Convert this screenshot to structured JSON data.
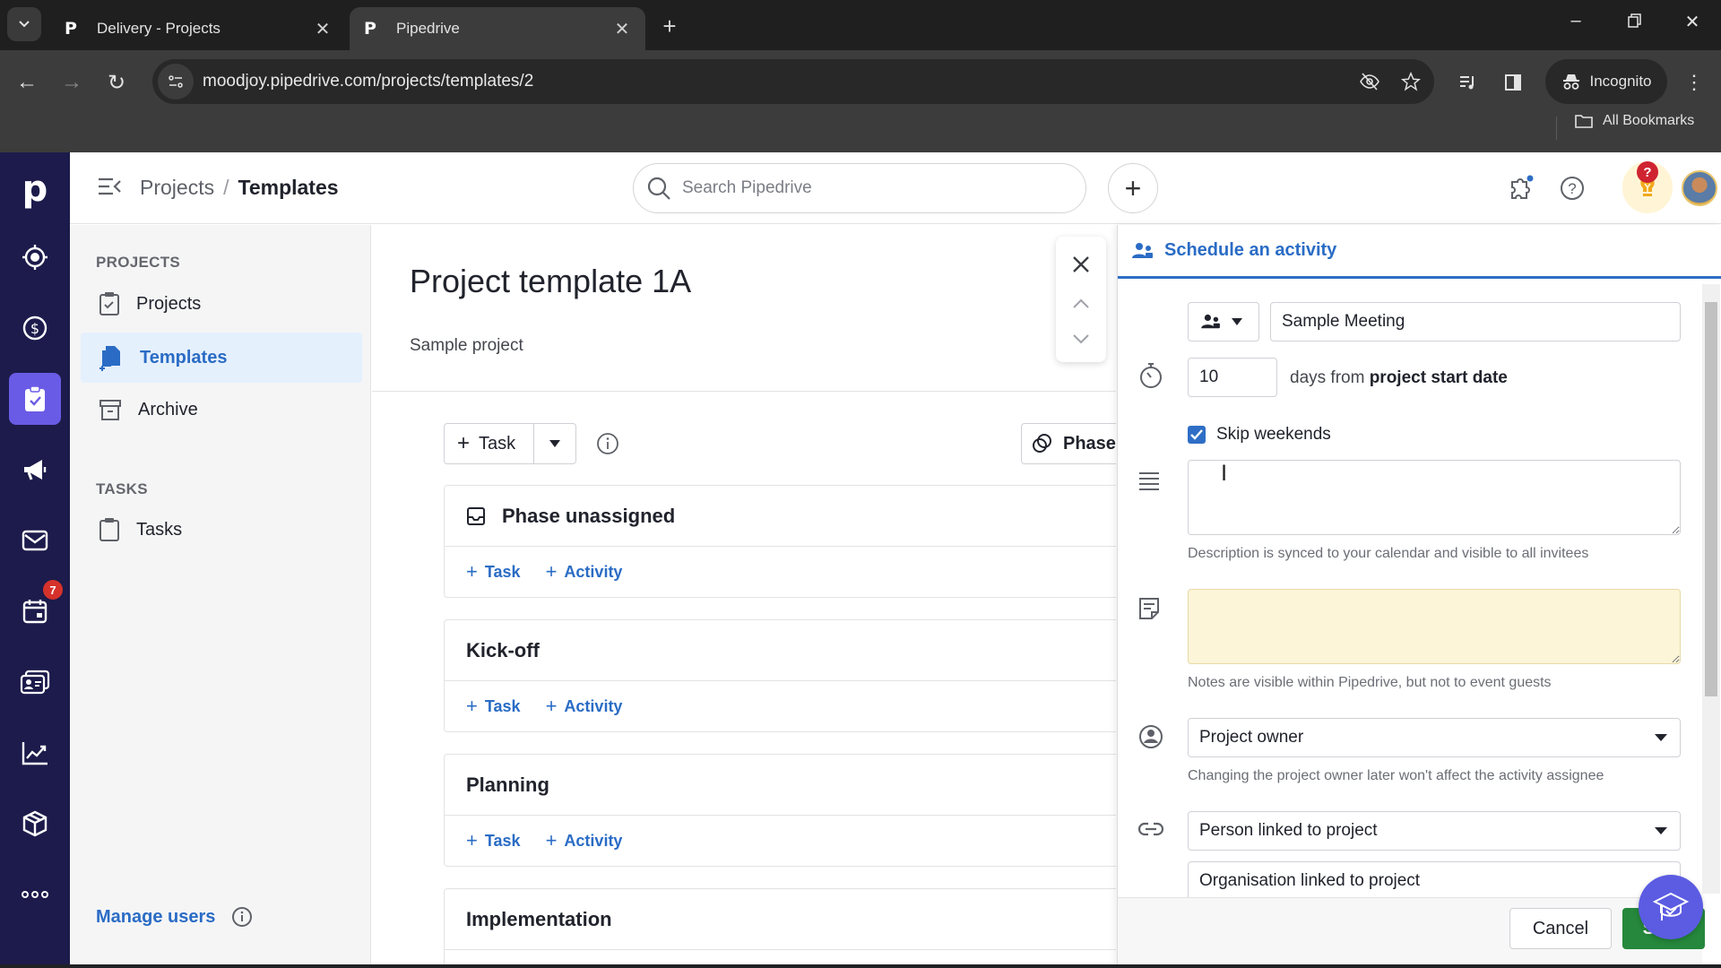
{
  "browser": {
    "tabs": [
      {
        "title": "Delivery - Projects",
        "favicon": "P",
        "active": false
      },
      {
        "title": "Pipedrive",
        "favicon": "P",
        "active": true
      }
    ],
    "url": "moodjoy.pipedrive.com/projects/templates/2",
    "incognito_label": "Incognito",
    "bookmarks_label": "All Bookmarks"
  },
  "app": {
    "rail": {
      "logo": "p",
      "items": [
        {
          "icon": "target-icon",
          "label": "Leads"
        },
        {
          "icon": "dollar-icon",
          "label": "Deals"
        },
        {
          "icon": "clipboard-check-icon",
          "label": "Projects",
          "active": true
        },
        {
          "icon": "megaphone-icon",
          "label": "Campaigns"
        },
        {
          "icon": "mail-icon",
          "label": "Mail"
        },
        {
          "icon": "calendar-icon",
          "label": "Activities",
          "badge": "7"
        },
        {
          "icon": "contacts-icon",
          "label": "Contacts"
        },
        {
          "icon": "chart-icon",
          "label": "Insights"
        },
        {
          "icon": "box-icon",
          "label": "Products"
        },
        {
          "icon": "more-icon",
          "label": "More"
        }
      ]
    },
    "topbar": {
      "breadcrumb": {
        "parent": "Projects",
        "separator": "/",
        "current": "Templates"
      },
      "search_placeholder": "Search Pipedrive",
      "add_label": "+",
      "notification_badge": "?"
    },
    "sidebar": {
      "sections": [
        {
          "heading": "PROJECTS",
          "items": [
            {
              "label": "Projects",
              "icon": "clipboard-check-icon"
            },
            {
              "label": "Templates",
              "icon": "template-icon",
              "selected": true
            },
            {
              "label": "Archive",
              "icon": "archive-icon"
            }
          ]
        },
        {
          "heading": "TASKS",
          "items": [
            {
              "label": "Tasks",
              "icon": "clipboard-icon"
            }
          ]
        }
      ],
      "manage_users": "Manage users"
    },
    "main": {
      "title": "Project template 1A",
      "subtitle": "Sample project",
      "task_button": "Task",
      "phases_button": "Phases",
      "phases": [
        {
          "name": "Phase unassigned",
          "has_icon": true
        },
        {
          "name": "Kick-off"
        },
        {
          "name": "Planning"
        },
        {
          "name": "Implementation"
        }
      ],
      "add_task": "Task",
      "add_activity": "Activity"
    },
    "panel": {
      "title": "Schedule an activity",
      "activity_subject": "Sample Meeting",
      "days_value": "10",
      "days_text": "days from",
      "days_anchor": "project start date",
      "skip_weekends_label": "Skip weekends",
      "skip_weekends_checked": true,
      "description_value": "",
      "description_helper": "Description is synced to your calendar and visible to all invitees",
      "notes_value": "",
      "notes_helper": "Notes are visible within Pipedrive, but not to event guests",
      "assignee": "Project owner",
      "assignee_helper": "Changing the project owner later won't affect the activity assignee",
      "person_link": "Person linked to project",
      "organisation_link": "Organisation linked to project",
      "cancel_label": "Cancel",
      "save_label": "Save"
    }
  }
}
